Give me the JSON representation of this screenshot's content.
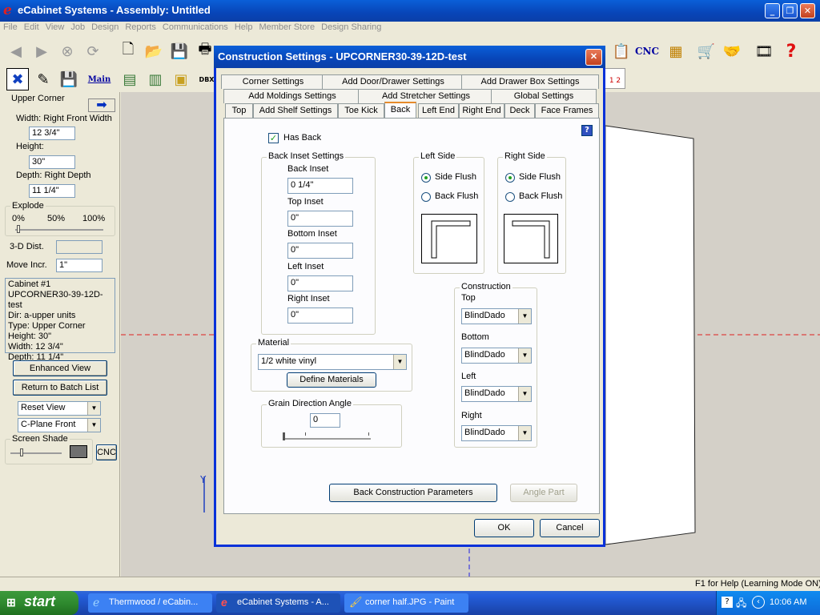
{
  "app": {
    "title": "eCabinet Systems - Assembly: Untitled",
    "menu": [
      "File",
      "Edit",
      "View",
      "Job",
      "Design",
      "Reports",
      "Communications",
      "Help",
      "Member Store",
      "Design Sharing"
    ],
    "toolbar_cnc": "CNC",
    "toolbar2_main": "Main",
    "toolbar2_dbx": "DBX"
  },
  "left_panel": {
    "cabinet_type": "Upper Corner",
    "width_label": "Width: Right Front Width",
    "width_value": "12 3/4\"",
    "height_label": "Height:",
    "height_value": "30\"",
    "depth_label": "Depth: Right Depth",
    "depth_value": "11 1/4\"",
    "explode_label": "Explode",
    "explode_ticks": [
      "0%",
      "50%",
      "100%"
    ],
    "dist_label": "3-D Dist.",
    "dist_value": "",
    "move_label": "Move Incr.",
    "move_value": "1\"",
    "info": [
      "Cabinet #1",
      "UPCORNER30-39-12D-test",
      "Dir: a-upper units",
      "Type: Upper Corner",
      "Height: 30\"",
      "Width: 12 3/4\"",
      "Depth: 11 1/4\""
    ],
    "enhanced_view": "Enhanced View",
    "return_batch": "Return to Batch List",
    "reset_view": "Reset View",
    "cplane": "C-Plane Front",
    "screen_shade": "Screen Shade",
    "cnc": "CNC"
  },
  "dialog": {
    "title": "Construction Settings - UPCORNER30-39-12D-test",
    "tabs_row1": [
      "Corner Settings",
      "Add Door/Drawer Settings",
      "Add Drawer Box Settings"
    ],
    "tabs_row2": [
      "Add Moldings Settings",
      "Add Stretcher Settings",
      "Global Settings"
    ],
    "tabs_row3": [
      "Top",
      "Add Shelf Settings",
      "Toe Kick",
      "Back",
      "Left End",
      "Right End",
      "Deck",
      "Face Frames"
    ],
    "has_back": "Has Back",
    "back_inset_group": "Back Inset Settings",
    "back_inset_label": "Back Inset",
    "back_inset_value": "0 1/4\"",
    "top_inset_label": "Top Inset",
    "top_inset_value": "0\"",
    "bottom_inset_label": "Bottom Inset",
    "bottom_inset_value": "0\"",
    "left_inset_label": "Left Inset",
    "left_inset_value": "0\"",
    "right_inset_label": "Right Inset",
    "right_inset_value": "0\"",
    "left_side_group": "Left Side",
    "right_side_group": "Right Side",
    "side_flush": "Side Flush",
    "back_flush": "Back Flush",
    "construction_group": "Construction",
    "c_top_label": "Top",
    "c_top_value": "BlindDado",
    "c_bottom_label": "Bottom",
    "c_bottom_value": "BlindDado",
    "c_left_label": "Left",
    "c_left_value": "BlindDado",
    "c_right_label": "Right",
    "c_right_value": "BlindDado",
    "material_group": "Material",
    "material_value": "1/2 white vinyl",
    "define_materials": "Define Materials",
    "grain_group": "Grain Direction Angle",
    "grain_value": "0",
    "back_params": "Back Construction Parameters",
    "angle_part": "Angle Part",
    "ok": "OK",
    "cancel": "Cancel"
  },
  "status_text": "F1 for Help (Learning Mode ON)",
  "taskbar": {
    "start": "start",
    "tasks": [
      "Thermwood / eCabin...",
      "eCabinet Systems - A...",
      "corner half.JPG - Paint"
    ],
    "time": "10:06 AM"
  }
}
